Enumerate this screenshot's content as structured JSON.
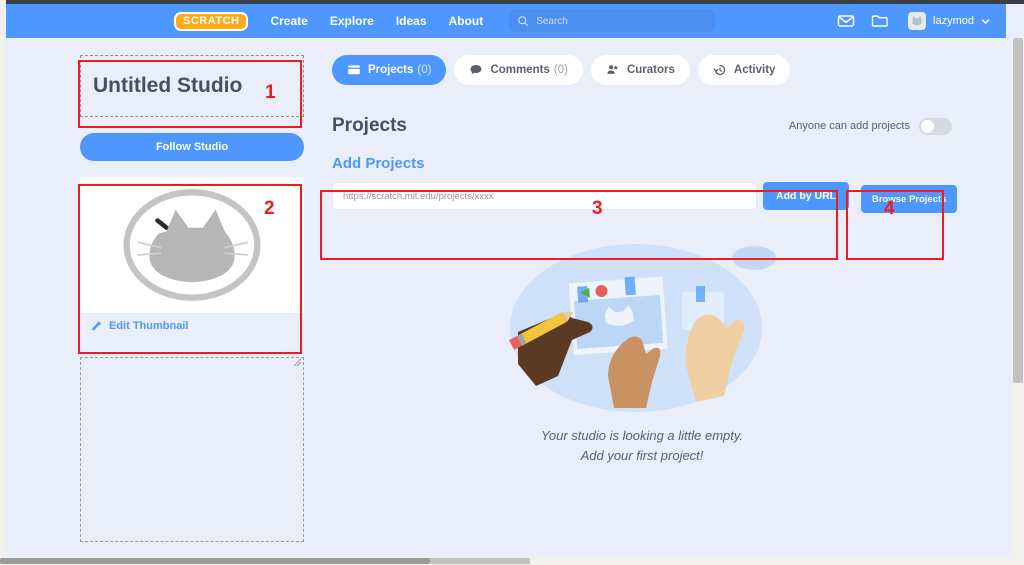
{
  "nav": {
    "logo_text": "SCRATCH",
    "links": [
      "Create",
      "Explore",
      "Ideas",
      "About"
    ],
    "search_placeholder": "Search",
    "username": "lazymod",
    "icons": {
      "search": "search-icon",
      "messages": "envelope-icon",
      "folder": "folder-icon",
      "chevron": "chevron-down-icon"
    }
  },
  "studio": {
    "title": "Untitled Studio",
    "follow_label": "Follow Studio",
    "edit_thumbnail_label": "Edit Thumbnail"
  },
  "tabs": [
    {
      "label": "Projects",
      "count": "(0)",
      "icon": "cards-icon",
      "active": true
    },
    {
      "label": "Comments",
      "count": "(0)",
      "icon": "comment-icon",
      "active": false
    },
    {
      "label": "Curators",
      "count": "",
      "icon": "people-icon",
      "active": false
    },
    {
      "label": "Activity",
      "count": "",
      "icon": "history-icon",
      "active": false
    }
  ],
  "projects": {
    "heading": "Projects",
    "toggle_label": "Anyone can add projects",
    "toggle_on": false,
    "add_title": "Add Projects",
    "url_placeholder": "https://scratch.mit.edu/projects/xxxx",
    "url_value": "",
    "add_by_url_label": "Add by URL",
    "browse_label": "Browse Projects",
    "empty_line1": "Your studio is looking a little empty.",
    "empty_line2": "Add your first project!"
  },
  "annotations": [
    {
      "number": "1"
    },
    {
      "number": "2"
    },
    {
      "number": "3"
    },
    {
      "number": "4"
    }
  ],
  "colors": {
    "brand_blue": "#4d97ff",
    "page_bg": "#e9eefa",
    "annotation_red": "#ee1c1c",
    "logo_orange": "#ffab19"
  }
}
